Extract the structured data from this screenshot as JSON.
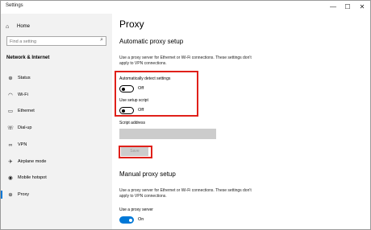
{
  "window": {
    "title": "Settings",
    "minimize": "—",
    "maximize": "☐",
    "close": "✕"
  },
  "sidebar": {
    "home": {
      "label": "Home",
      "icon": "home-icon"
    },
    "search": {
      "placeholder": "Find a setting",
      "icon": "search-icon"
    },
    "section_title": "Network & Internet",
    "items": [
      {
        "label": "Status",
        "icon": "globe-icon"
      },
      {
        "label": "Wi-Fi",
        "icon": "wifi-icon"
      },
      {
        "label": "Ethernet",
        "icon": "ethernet-icon"
      },
      {
        "label": "Dial-up",
        "icon": "phone-icon"
      },
      {
        "label": "VPN",
        "icon": "vpn-icon"
      },
      {
        "label": "Airplane mode",
        "icon": "airplane-icon"
      },
      {
        "label": "Mobile hotspot",
        "icon": "hotspot-icon"
      },
      {
        "label": "Proxy",
        "icon": "globe-icon",
        "active": true
      }
    ]
  },
  "main": {
    "title": "Proxy",
    "auto": {
      "heading": "Automatic proxy setup",
      "description": "Use a proxy server for Ethernet or Wi-Fi connections. These settings don't apply to VPN connections.",
      "detect_label": "Automatically detect settings",
      "detect_state": "Off",
      "script_label": "Use setup script",
      "script_state": "Off",
      "address_label": "Script address",
      "address_value": "",
      "save_label": "Save"
    },
    "manual": {
      "heading": "Manual proxy setup",
      "description": "Use a proxy server for Ethernet or Wi-Fi connections. These settings don't apply to VPN connections.",
      "use_proxy_label": "Use a proxy server",
      "use_proxy_state": "On"
    }
  },
  "colors": {
    "accent": "#0078d7",
    "highlight": "#e0201a",
    "sidebar_bg": "#f2f2f2"
  }
}
